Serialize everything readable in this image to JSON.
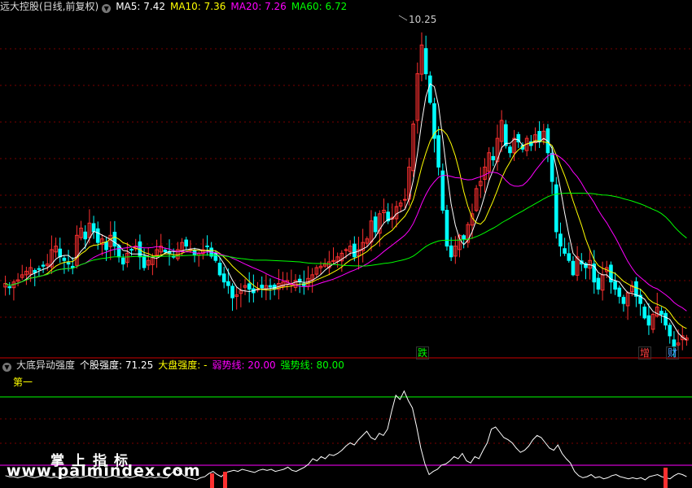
{
  "main_header": {
    "title": "远大控股(日线,前复权)",
    "ma5": "MA5: 7.42",
    "ma10": "MA10: 7.36",
    "ma20": "MA20: 7.26",
    "ma60": "MA60: 6.72"
  },
  "sub_header": {
    "title": "大底异动强度",
    "stock_strength": "个股强度: 71.25",
    "market_strength": "大盘强度: -",
    "weak_line": "弱势线: 20.00",
    "strong_line": "强势线: 80.00"
  },
  "sub_label": "第一",
  "peak_label": "10.25",
  "event_tags": [
    {
      "text": "跌",
      "color": "#00ff00"
    },
    {
      "text": "增",
      "color": "#ff4040"
    },
    {
      "text": "财",
      "color": "#4aa0ff"
    }
  ],
  "watermark": {
    "line1": "掌上指标",
    "line2": "www.palmindex.com"
  },
  "colors": {
    "up": "#ff3030",
    "down": "#00ffff",
    "ma5": "#ffffff",
    "ma10": "#ffff00",
    "ma20": "#ff00ff",
    "ma60": "#00ff00",
    "strong_line": "#00ff00",
    "weak_line": "#ff00ff",
    "indicator": "#ffffff",
    "divider": "#cc0000"
  },
  "price_axis": {
    "min": 5.6,
    "max": 10.3
  },
  "indicator_axis": {
    "min": 0,
    "max": 100
  },
  "close_prices": [
    6.58,
    6.52,
    6.6,
    6.63,
    6.7,
    6.75,
    6.8,
    6.73,
    6.78,
    6.82,
    6.85,
    7.05,
    7.1,
    6.95,
    6.9,
    6.85,
    6.8,
    7.25,
    7.35,
    7.2,
    7.42,
    7.3,
    7.15,
    7.2,
    7.05,
    7.25,
    7.1,
    6.95,
    6.85,
    7.0,
    7.05,
    7.1,
    6.95,
    6.8,
    6.9,
    6.95,
    7.05,
    7.1,
    7.02,
    7.0,
    6.95,
    7.05,
    7.15,
    7.1,
    7.05,
    6.98,
    7.0,
    7.05,
    7.1,
    6.96,
    6.9,
    6.7,
    6.6,
    6.55,
    6.38,
    6.42,
    6.48,
    6.55,
    6.5,
    6.45,
    6.5,
    6.52,
    6.55,
    6.53,
    6.5,
    6.58,
    6.6,
    6.62,
    6.58,
    6.62,
    6.6,
    6.55,
    6.65,
    6.7,
    6.8,
    6.82,
    6.85,
    6.88,
    6.9,
    6.95,
    7.0,
    7.05,
    7.1,
    6.95,
    7.05,
    7.15,
    7.2,
    7.45,
    7.3,
    7.55,
    7.6,
    7.45,
    7.5,
    7.65,
    7.7,
    7.75,
    8.2,
    8.8,
    9.5,
    9.9,
    9.5,
    9.1,
    8.6,
    8.2,
    7.6,
    7.1,
    6.95,
    7.1,
    7.25,
    7.2,
    7.4,
    7.55,
    7.9,
    8.0,
    8.2,
    8.4,
    8.3,
    8.6,
    8.85,
    8.5,
    8.4,
    8.6,
    8.55,
    8.45,
    8.6,
    8.5,
    8.65,
    8.55,
    8.7,
    8.4,
    8.0,
    7.3,
    7.1,
    7.0,
    6.9,
    6.7,
    6.95,
    6.85,
    6.8,
    6.9,
    6.6,
    6.5,
    6.7,
    6.8,
    6.6,
    6.5,
    6.4,
    6.3,
    6.45,
    6.55,
    6.4,
    6.3,
    6.1,
    6.0,
    6.15,
    6.25,
    6.15,
    6.0,
    5.85,
    5.7,
    5.75,
    5.85,
    5.82
  ],
  "indicator_values": [
    4,
    3,
    3,
    2,
    3,
    4,
    3,
    2,
    3,
    4,
    3,
    2,
    3,
    2,
    2,
    3,
    2,
    3,
    2,
    3,
    4,
    3,
    2,
    3,
    2,
    3,
    4,
    3,
    2,
    3,
    2,
    3,
    4,
    3,
    2,
    3,
    2,
    3,
    2,
    2,
    6,
    10,
    8,
    4,
    2,
    1,
    0,
    2,
    3,
    6,
    8,
    5,
    3,
    7,
    8,
    9,
    8,
    10,
    9,
    8,
    7,
    9,
    10,
    9,
    10,
    8,
    9,
    10,
    12,
    9,
    8,
    10,
    12,
    15,
    20,
    18,
    22,
    20,
    24,
    23,
    25,
    28,
    32,
    35,
    33,
    38,
    42,
    46,
    40,
    38,
    44,
    42,
    48,
    65,
    80,
    76,
    84,
    75,
    68,
    50,
    30,
    15,
    5,
    8,
    10,
    14,
    15,
    18,
    22,
    20,
    25,
    18,
    16,
    22,
    20,
    28,
    35,
    48,
    50,
    45,
    40,
    38,
    35,
    30,
    26,
    28,
    32,
    38,
    42,
    40,
    35,
    30,
    28,
    33,
    25,
    20,
    16,
    8,
    4,
    2,
    3,
    5,
    2,
    3,
    1,
    2,
    4,
    5,
    3,
    2,
    1,
    2,
    1,
    2,
    0,
    3,
    4,
    5,
    3,
    2,
    1,
    4,
    6,
    5,
    3
  ]
}
